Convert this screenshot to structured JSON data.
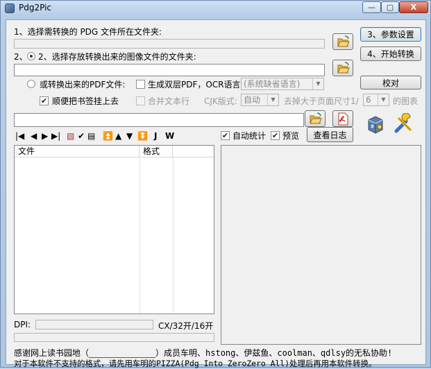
{
  "window": {
    "title": "Pdg2Pic",
    "minimize": "—",
    "maximize": "▢",
    "close": "X"
  },
  "step1": {
    "label": "1、选择需转换的 PDG 文件所在文件夹:",
    "path": "",
    "button": "3、参数设置"
  },
  "step2": {
    "label": "2、选择存放转换出来的图像文件的文件夹:",
    "path": "",
    "button": "4、开始转换"
  },
  "pdf_options": {
    "radio_label": "或转换出来的PDF文件:",
    "dual_layer_label": "生成双层PDF，OCR语言:",
    "ocr_language": "(系统缺省语言)",
    "proofread_button": "校对",
    "bookmark_label": "顺便把书签挂上去",
    "merge_text_label": "合并文本行",
    "cjk_label": "CJK版式:",
    "cjk_value": "自动",
    "remove_larger_label": "去掉大于页面尺寸1/",
    "remove_larger_value": "6",
    "figure_suffix": "的图表",
    "pdf_path": ""
  },
  "toolbar": {
    "icons": [
      "first-icon",
      "prev-icon",
      "next-icon",
      "last-icon",
      "new-page-icon",
      "check-icon",
      "export-icon",
      "top-icon",
      "up-icon",
      "down-icon",
      "bottom-icon",
      "jump-icon",
      "wrap-icon"
    ],
    "glyphs": [
      "⏮",
      "◀",
      "▶",
      "⏭",
      "▧",
      "✔",
      "▤",
      "⏫",
      "▲",
      "▼",
      "⏬",
      "J",
      "W"
    ]
  },
  "options_right": {
    "auto_stats_label": "自动统计",
    "preview_label": "预览",
    "log_button": "查看日志"
  },
  "file_table": {
    "columns": [
      "文件",
      "格式"
    ],
    "rows": []
  },
  "dpi": {
    "label": "DPI:",
    "value": "",
    "size_text": "CX/32开/16开"
  },
  "footer": {
    "line1_prefix": "感谢网上读书园地（",
    "line1_link": "________________",
    "line1_suffix": "）成员车明、hstong、伊兹鱼、coolman、qdlsy的无私协助!",
    "line2": "对于本软件不支持的格式，请先用车明的PIZZA(Pdg Into ZeroZero All)处理后再用本软件转换。"
  },
  "colors": {
    "accent": "#3c7fb1",
    "window_frame": "#b9d1ea",
    "client_bg": "#f0f0f0",
    "link": "#1a3fb8"
  }
}
